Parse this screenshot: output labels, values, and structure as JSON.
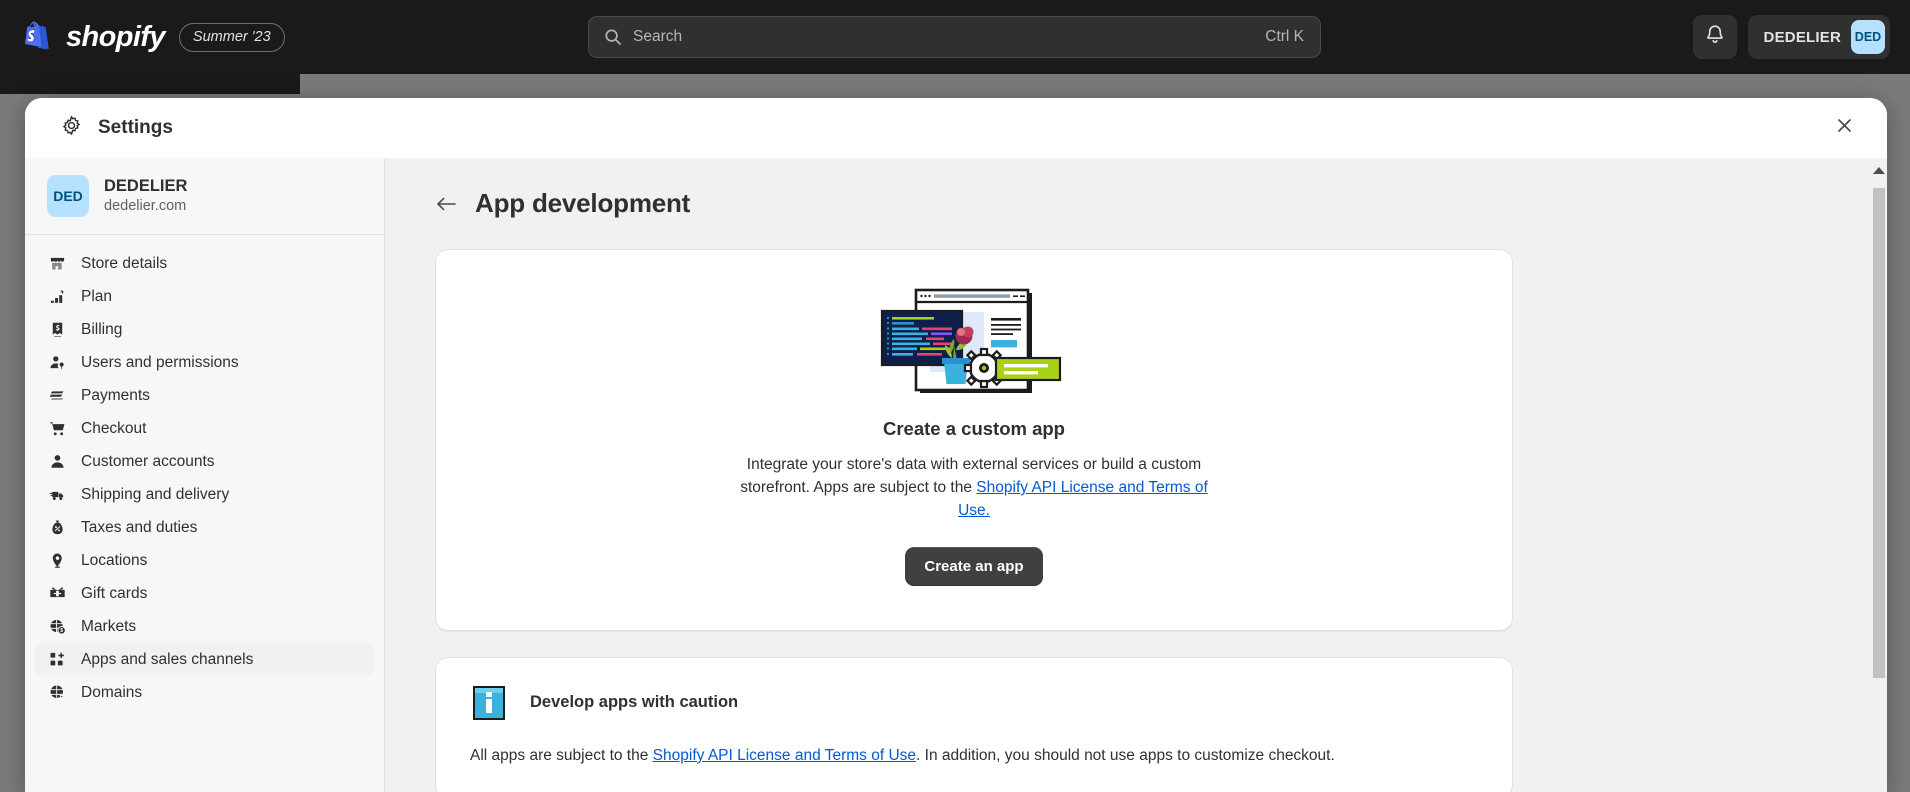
{
  "topbar": {
    "brand_word": "shopify",
    "brand_icon": "shopify-bag-icon",
    "season_badge": "Summer '23",
    "search": {
      "icon": "search-icon",
      "placeholder": "Search",
      "shortcut": "Ctrl K"
    },
    "notifications_icon": "bell-icon",
    "user_name": "DEDELIER",
    "user_initials": "DED"
  },
  "modal": {
    "icon": "gear-icon",
    "title": "Settings",
    "close_icon": "close-icon"
  },
  "sidebar": {
    "store": {
      "initials": "DED",
      "name": "DEDELIER",
      "domain": "dedelier.com"
    },
    "items": [
      {
        "label": "Store details",
        "icon": "store-icon",
        "selected": false
      },
      {
        "label": "Plan",
        "icon": "plan-chart-icon",
        "selected": false
      },
      {
        "label": "Billing",
        "icon": "billing-receipt-icon",
        "selected": false
      },
      {
        "label": "Users and permissions",
        "icon": "users-permissions-icon",
        "selected": false
      },
      {
        "label": "Payments",
        "icon": "payments-card-icon",
        "selected": false
      },
      {
        "label": "Checkout",
        "icon": "checkout-cart-icon",
        "selected": false
      },
      {
        "label": "Customer accounts",
        "icon": "customer-person-icon",
        "selected": false
      },
      {
        "label": "Shipping and delivery",
        "icon": "shipping-truck-icon",
        "selected": false
      },
      {
        "label": "Taxes and duties",
        "icon": "taxes-moneybag-icon",
        "selected": false
      },
      {
        "label": "Locations",
        "icon": "location-pin-icon",
        "selected": false
      },
      {
        "label": "Gift cards",
        "icon": "gift-card-icon",
        "selected": false
      },
      {
        "label": "Markets",
        "icon": "markets-globe-icon",
        "selected": false
      },
      {
        "label": "Apps and sales channels",
        "icon": "apps-grid-icon",
        "selected": true
      },
      {
        "label": "Domains",
        "icon": "domains-globe-icon",
        "selected": false
      }
    ]
  },
  "main": {
    "back_icon": "back-arrow-icon",
    "title": "App development",
    "empty_state": {
      "illustration": "custom-app-illustration",
      "title": "Create a custom app",
      "description_before": "Integrate your store's data with external services or build a custom storefront. Apps are subject to the ",
      "link_text": "Shopify API License and Terms of Use.",
      "button_label": "Create an app"
    },
    "caution": {
      "icon": "info-icon",
      "title": "Develop apps with caution",
      "body_before": "All apps are subject to the ",
      "link_text": "Shopify API License and Terms of Use",
      "body_after": ". In addition, you should not use apps to customize checkout."
    }
  },
  "colors": {
    "topbar_bg": "#1a1a1a",
    "accent_blue": "#005bd3",
    "avatar_bg": "#b5e1ff",
    "avatar_text": "#00527c",
    "primary_button_bg": "#404040",
    "panel_bg": "#f1f1f1",
    "sidebar_bg": "#f7f7f7"
  }
}
